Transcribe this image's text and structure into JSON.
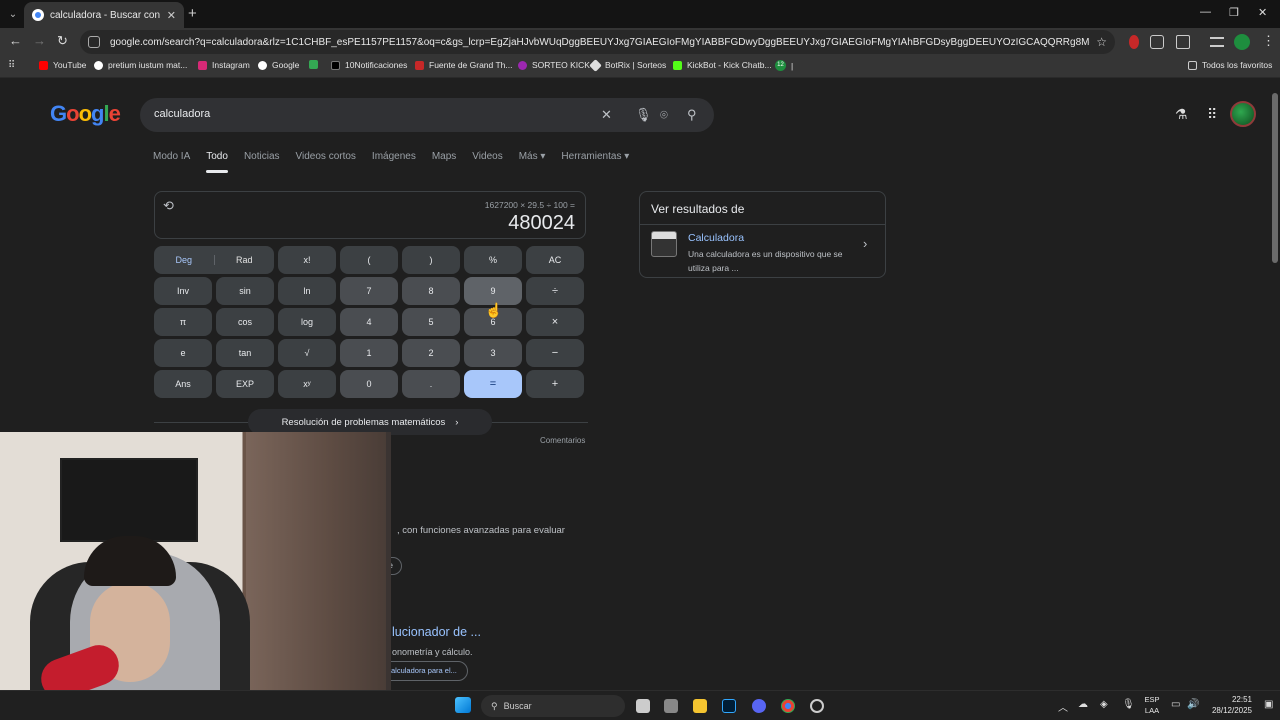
{
  "browser": {
    "tab_title": "calculadora - Buscar con Googl",
    "url": "google.com/search?q=calculadora&rlz=1C1CHBF_esPE1157PE1157&oq=c&gs_lcrp=EgZjaHJvbWUqDggBEEUYJxg7GIAEGIoFMgYIABBFGDwyDggBEEUYJxg7GIAEGIoFMgYIAhBFGDsyBggDEEUYOzIGCAQQRRg8MgYIBRBFGDwyBggGEEUYP...",
    "bookmarks": [
      "YouTube",
      "pretium iustum mat...",
      "Instagram",
      "Google",
      "10Notificaciones",
      "Fuente de Grand Th...",
      "SORTEO KICK",
      "BotRix | Sorteos",
      "KickBot - Kick Chatb...",
      "|"
    ],
    "bookmark_badge": "12",
    "all_bookmarks": "Todos los favoritos"
  },
  "search": {
    "query": "calculadora",
    "tabs": [
      "Modo IA",
      "Todo",
      "Noticias",
      "Videos cortos",
      "Imágenes",
      "Maps",
      "Videos",
      "Más",
      "Herramientas"
    ],
    "active_tab": "Todo"
  },
  "calculator": {
    "expression": "1627200 × 29.5 ÷ 100 =",
    "result": "480024",
    "deg": "Deg",
    "rad": "Rad",
    "keys": [
      [
        "x!",
        "(",
        ")",
        "%",
        "AC"
      ],
      [
        "Inv",
        "sin",
        "ln",
        "7",
        "8",
        "9",
        "÷"
      ],
      [
        "π",
        "cos",
        "log",
        "4",
        "5",
        "6",
        "×"
      ],
      [
        "e",
        "tan",
        "√",
        "1",
        "2",
        "3",
        "−"
      ],
      [
        "Ans",
        "EXP",
        "xʸ",
        "0",
        ".",
        "=",
        "+"
      ]
    ],
    "math_help": "Resolución de problemas matemáticos",
    "feedback": "Comentarios"
  },
  "results": {
    "snippet1": ", con funciones avanzadas para evaluar",
    "chip1": "e",
    "r2_title": "lucionador de ...",
    "r2_snippet": "onometría y cálculo.",
    "chip2": "alculadora para el..."
  },
  "side_card": {
    "header": "Ver resultados de",
    "title": "Calculadora",
    "desc": "Una calculadora es un dispositivo que se utiliza para ..."
  },
  "taskbar": {
    "search": "Buscar",
    "lang1": "ESP",
    "lang2": "LAA",
    "time": "22:51",
    "date": "28/12/2025"
  }
}
